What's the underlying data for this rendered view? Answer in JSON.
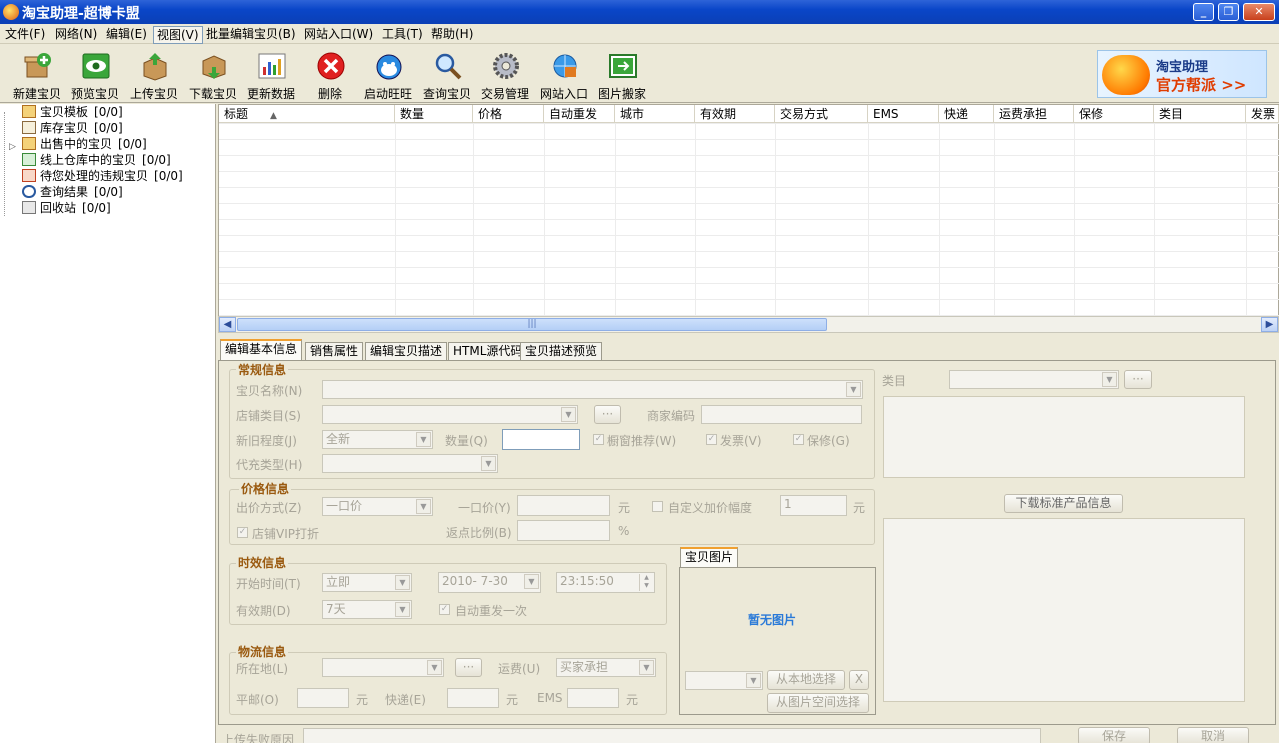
{
  "window": {
    "title": "淘宝助理-超博卡盟",
    "buttons": [
      "minimize",
      "restore",
      "close"
    ]
  },
  "menu": [
    {
      "label": "文件(F)",
      "active": false
    },
    {
      "label": "网络(N)",
      "active": false
    },
    {
      "label": "编辑(E)",
      "active": false
    },
    {
      "label": "视图(V)",
      "active": true
    },
    {
      "label": "批量编辑宝贝(B)",
      "active": false
    },
    {
      "label": "网站入口(W)",
      "active": false
    },
    {
      "label": "工具(T)",
      "active": false
    },
    {
      "label": "帮助(H)",
      "active": false
    }
  ],
  "toolbar": [
    {
      "label": "新建宝贝",
      "icon": "new-item-icon"
    },
    {
      "label": "预览宝贝",
      "icon": "preview-eye-icon"
    },
    {
      "label": "上传宝贝",
      "icon": "upload-box-icon"
    },
    {
      "label": "下载宝贝",
      "icon": "download-box-icon"
    },
    {
      "label": "更新数据",
      "icon": "chart-icon"
    },
    {
      "label": "删除",
      "icon": "delete-x-icon"
    },
    {
      "label": "启动旺旺",
      "icon": "wangwang-icon"
    },
    {
      "label": "查询宝贝",
      "icon": "magnifier-icon"
    },
    {
      "label": "交易管理",
      "icon": "gear-icon"
    },
    {
      "label": "网站入口",
      "icon": "ie-globe-icon"
    },
    {
      "label": "图片搬家",
      "icon": "picture-move-icon"
    }
  ],
  "ad": {
    "line1": "淘宝助理",
    "line2": "官方帮派 >>"
  },
  "tree": [
    {
      "label": "宝贝模板",
      "count": "[0/0]"
    },
    {
      "label": "库存宝贝",
      "count": "[0/0]"
    },
    {
      "label": "出售中的宝贝",
      "count": "[0/0]"
    },
    {
      "label": "线上仓库中的宝贝",
      "count": "[0/0]"
    },
    {
      "label": "待您处理的违规宝贝",
      "count": "[0/0]"
    },
    {
      "label": "查询结果",
      "count": "[0/0]"
    },
    {
      "label": "回收站",
      "count": "[0/0]"
    }
  ],
  "grid": {
    "columns": [
      "标题",
      "数量",
      "价格",
      "自动重发",
      "城市",
      "有效期",
      "交易方式",
      "EMS",
      "快递",
      "运费承担",
      "保修",
      "类目",
      "发票"
    ],
    "sort_indicator": "▲"
  },
  "tabs": [
    "编辑基本信息",
    "销售属性",
    "编辑宝贝描述",
    "HTML源代码",
    "宝贝描述预览"
  ],
  "form": {
    "general": {
      "title": "常规信息",
      "name_label": "宝贝名称(N)",
      "category_label": "店铺类目(S)",
      "condition_label": "新旧程度(J)",
      "condition_value": "全新",
      "quantity_label": "数量(Q)",
      "showcase_label": "橱窗推荐(W)",
      "invoice_label": "发票(V)",
      "warranty_label": "保修(G)",
      "recharge_label": "代充类型(H)",
      "merchant_code_label": "商家编码"
    },
    "price": {
      "title": "价格信息",
      "method_label": "出价方式(Z)",
      "method_value": "一口价",
      "fixed_label": "一口价(Y)",
      "unit": "元",
      "custom_label": "自定义加价幅度",
      "custom_value": "1",
      "vip_label": "店铺VIP打折",
      "rebate_label": "返点比例(B)",
      "percent": "%"
    },
    "time": {
      "title": "时效信息",
      "start_label": "开始时间(T)",
      "start_value": "立即",
      "date_value": "2010- 7-30",
      "time_value": "23:15:50",
      "period_label": "有效期(D)",
      "period_value": "7天",
      "auto_label": "自动重发一次"
    },
    "logistics": {
      "title": "物流信息",
      "location_label": "所在地(L)",
      "freight_label": "运费(U)",
      "freight_value": "买家承担",
      "mail_label": "平邮(O)",
      "express_label": "快递(E)",
      "ems_label": "EMS",
      "unit": "元"
    },
    "picture": {
      "tab": "宝贝图片",
      "empty": "暂无图片",
      "local_btn": "从本地选择",
      "x_btn": "X",
      "space_btn": "从图片空间选择"
    },
    "right": {
      "category_label": "类目",
      "download_btn": "下载标准产品信息"
    },
    "ellipsis": "···"
  },
  "status": {
    "fail_label": "上传失败原因",
    "save_btn": "保存",
    "cancel_btn": "取消"
  }
}
